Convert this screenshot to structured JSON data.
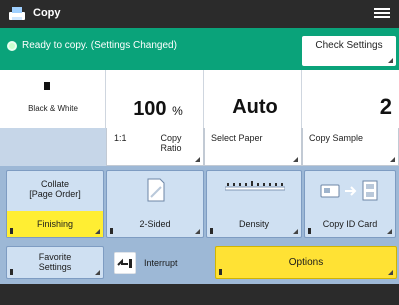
{
  "titlebar": {
    "title": "Copy",
    "app_icon": "copy-app-icon",
    "menu_icon": "menu-icon"
  },
  "status": {
    "text": "Ready to copy. (Settings Changed)",
    "check_settings": "Check Settings",
    "icon": "ok-icon"
  },
  "summary": {
    "color_mode_label": "Black & White",
    "color_mode_icon": "black-white-icon",
    "ratio_value": "100",
    "ratio_unit": "%",
    "paper_value": "Auto",
    "copies": "2"
  },
  "mid_buttons": {
    "ratio_prefix": "1:1",
    "ratio_label_line1": "Copy",
    "ratio_label_line2": "Ratio",
    "select_paper": "Select Paper",
    "copy_sample": "Copy Sample"
  },
  "functions": {
    "collate_line1": "Collate",
    "collate_line2": "[Page Order]",
    "finishing": "Finishing",
    "two_sided": "2-Sided",
    "density": "Density",
    "copy_id_card": "Copy ID Card",
    "favorite_line1": "Favorite",
    "favorite_line2": "Settings",
    "interrupt": "Interrupt",
    "options": "Options"
  },
  "icons": {
    "two_sided": "two-sided-icon",
    "density": "density-icon",
    "id_card": "id-card-icon",
    "interrupt": "interrupt-icon"
  },
  "colors": {
    "status_green": "#0aa37a",
    "highlight_yellow": "#ffee33",
    "button_blue": "#cfe0f2"
  }
}
